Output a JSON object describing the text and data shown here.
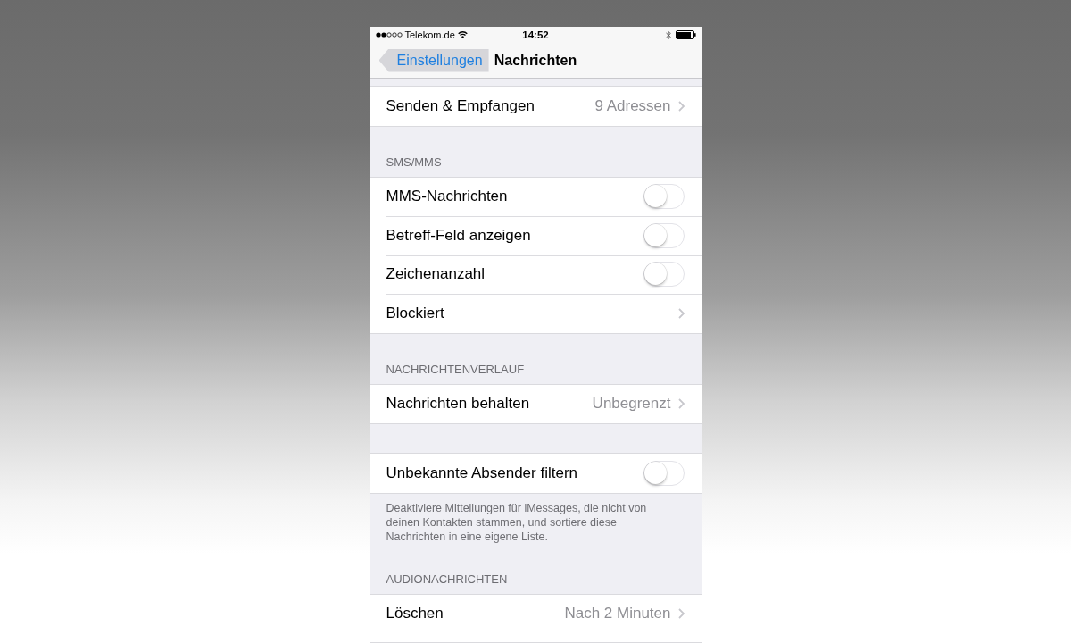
{
  "status_bar": {
    "carrier": "Telekom.de",
    "time": "14:52"
  },
  "nav_bar": {
    "back_button": {
      "label": "Einstellungen",
      "pressed": true
    },
    "title": "Nachrichten"
  },
  "groups": [
    {
      "rows": [
        {
          "kind": "link",
          "label": "Senden & Empfangen",
          "value": "9 Adressen"
        }
      ]
    },
    {
      "header": "SMS/MMS",
      "rows": [
        {
          "kind": "switch",
          "label": "MMS-Nachrichten",
          "on": false
        },
        {
          "kind": "switch",
          "label": "Betreff-Feld anzeigen",
          "on": false
        },
        {
          "kind": "switch",
          "label": "Zeichenanzahl",
          "on": false
        },
        {
          "kind": "link",
          "label": "Blockiert"
        }
      ]
    },
    {
      "header": "NACHRICHTENVERLAUF",
      "rows": [
        {
          "kind": "link",
          "label": "Nachrichten behalten",
          "value": "Unbegrenzt"
        }
      ]
    },
    {
      "rows": [
        {
          "kind": "switch",
          "label": "Unbekannte Absender filtern",
          "on": false
        }
      ],
      "footer": "Deaktiviere Mitteilungen für iMessages, die nicht von deinen Kontakten stammen, und sortiere diese Nachrichten in eine eigene Liste."
    },
    {
      "header": "AUDIONACHRICHTEN",
      "rows": [
        {
          "kind": "link",
          "label": "Löschen",
          "value": "Nach 2 Minuten"
        }
      ]
    }
  ]
}
